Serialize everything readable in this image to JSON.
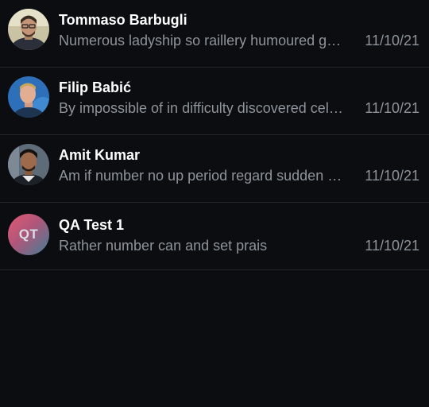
{
  "conversations": [
    {
      "name": "Tommaso Barbugli",
      "preview": "Numerous ladyship so raillery humoured goodness received",
      "date": "11/10/21",
      "avatar": "photo-avatar"
    },
    {
      "name": "Filip Babić",
      "preview": "By impossible of in difficulty discovered celebrated",
      "date": "11/10/21",
      "avatar": "photo-avatar"
    },
    {
      "name": "Amit Kumar",
      "preview": "Am if number no up period regard sudden better",
      "date": "11/10/21",
      "avatar": "photo-avatar"
    },
    {
      "name": "QA Test 1",
      "preview": "Rather number can and set prais",
      "date": "11/10/21",
      "avatar_initials": "QT"
    }
  ],
  "colors": {
    "background": "#0b0d10",
    "name_text": "#ffffff",
    "secondary_text": "#8e949b",
    "divider": "#23272c"
  }
}
